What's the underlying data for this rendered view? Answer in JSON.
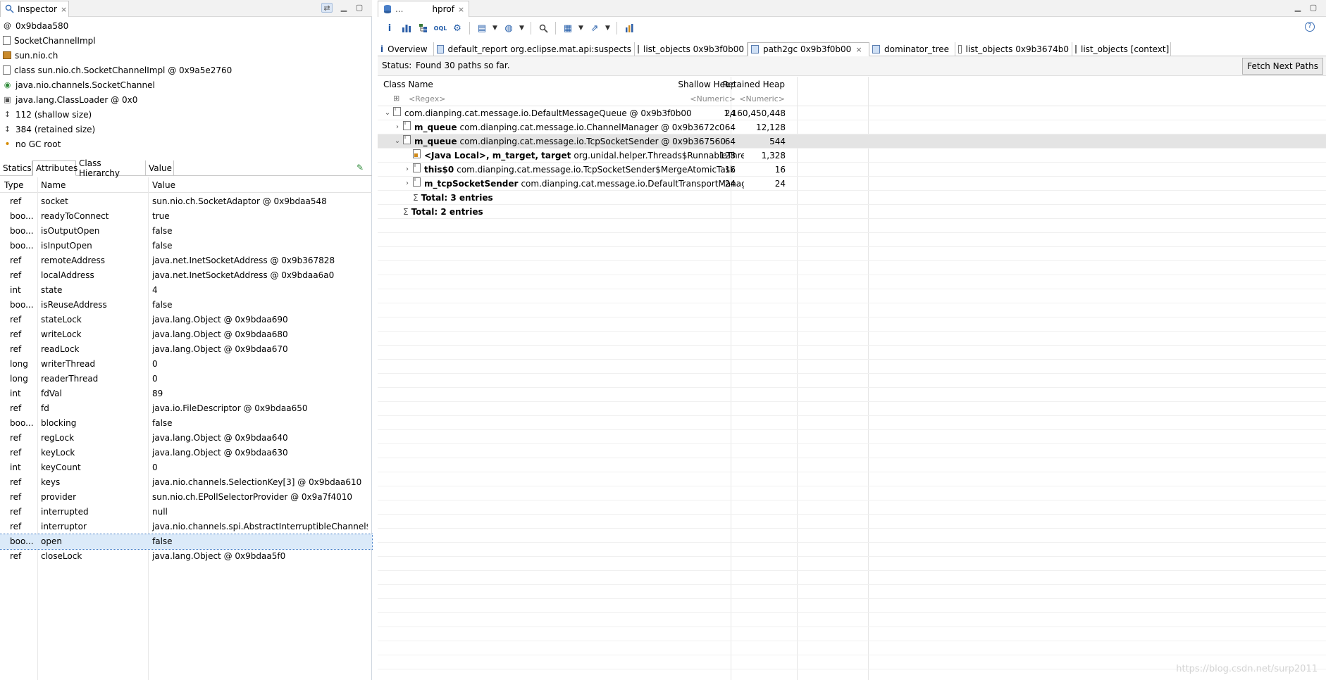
{
  "inspector": {
    "title": "Inspector",
    "close_glyph": "×",
    "info": [
      {
        "icon": "at-icon",
        "text": "0x9bdaa580"
      },
      {
        "icon": "class-doc-icon",
        "text": "SocketChannelImpl"
      },
      {
        "icon": "package-icon",
        "text": "sun.nio.ch"
      },
      {
        "icon": "class-doc-icon",
        "text": "class sun.nio.ch.SocketChannelImpl @ 0x9a5e2760"
      },
      {
        "icon": "interface-icon",
        "text": "java.nio.channels.SocketChannel"
      },
      {
        "icon": "classloader-icon",
        "text": "java.lang.ClassLoader @ 0x0"
      },
      {
        "icon": "size-icon",
        "text": "112 (shallow size)"
      },
      {
        "icon": "size-icon",
        "text": "384 (retained size)"
      },
      {
        "icon": "gc-root-icon",
        "text": "no GC root"
      }
    ],
    "tabs": [
      "Statics",
      "Attributes",
      "Class Hierarchy",
      "Value"
    ],
    "active_tab": "Attributes",
    "columns": {
      "type": "Type",
      "name": "Name",
      "value": "Value"
    },
    "rows": [
      {
        "type": "ref",
        "name": "socket",
        "value": "sun.nio.ch.SocketAdaptor @ 0x9bdaa548"
      },
      {
        "type": "boo...",
        "name": "readyToConnect",
        "value": "true"
      },
      {
        "type": "boo...",
        "name": "isOutputOpen",
        "value": "false"
      },
      {
        "type": "boo...",
        "name": "isInputOpen",
        "value": "false"
      },
      {
        "type": "ref",
        "name": "remoteAddress",
        "value": "java.net.InetSocketAddress @ 0x9b367828"
      },
      {
        "type": "ref",
        "name": "localAddress",
        "value": "java.net.InetSocketAddress @ 0x9bdaa6a0"
      },
      {
        "type": "int",
        "name": "state",
        "value": "4"
      },
      {
        "type": "boo...",
        "name": "isReuseAddress",
        "value": "false"
      },
      {
        "type": "ref",
        "name": "stateLock",
        "value": "java.lang.Object @ 0x9bdaa690"
      },
      {
        "type": "ref",
        "name": "writeLock",
        "value": "java.lang.Object @ 0x9bdaa680"
      },
      {
        "type": "ref",
        "name": "readLock",
        "value": "java.lang.Object @ 0x9bdaa670"
      },
      {
        "type": "long",
        "name": "writerThread",
        "value": "0"
      },
      {
        "type": "long",
        "name": "readerThread",
        "value": "0"
      },
      {
        "type": "int",
        "name": "fdVal",
        "value": "89"
      },
      {
        "type": "ref",
        "name": "fd",
        "value": "java.io.FileDescriptor @ 0x9bdaa650"
      },
      {
        "type": "boo...",
        "name": "blocking",
        "value": "false"
      },
      {
        "type": "ref",
        "name": "regLock",
        "value": "java.lang.Object @ 0x9bdaa640"
      },
      {
        "type": "ref",
        "name": "keyLock",
        "value": "java.lang.Object @ 0x9bdaa630"
      },
      {
        "type": "int",
        "name": "keyCount",
        "value": "0"
      },
      {
        "type": "ref",
        "name": "keys",
        "value": "java.nio.channels.SelectionKey[3] @ 0x9bdaa610"
      },
      {
        "type": "ref",
        "name": "provider",
        "value": "sun.nio.ch.EPollSelectorProvider @ 0x9a7f4010"
      },
      {
        "type": "ref",
        "name": "interrupted",
        "value": "null"
      },
      {
        "type": "ref",
        "name": "interruptor",
        "value": "java.nio.channels.spi.AbstractInterruptibleChannel$..."
      },
      {
        "type": "boo...",
        "name": "open",
        "value": "false",
        "selected": true
      },
      {
        "type": "ref",
        "name": "closeLock",
        "value": "java.lang.Object @ 0x9bdaa5f0"
      }
    ]
  },
  "editor": {
    "title_prefix": "...",
    "title": "hprof",
    "close_glyph": "×",
    "tabs": [
      {
        "label": "Overview",
        "icon": "info-icon"
      },
      {
        "label": "default_report  org.eclipse.mat.api:suspects",
        "icon": "report-icon"
      },
      {
        "label": "list_objects  0x9b3f0b00",
        "icon": "doc-icon"
      },
      {
        "label": "path2gc  0x9b3f0b00",
        "icon": "path-icon",
        "active": true
      },
      {
        "label": "dominator_tree",
        "icon": "tree-icon"
      },
      {
        "label": "list_objects  0x9b3674b0",
        "icon": "doc-icon"
      },
      {
        "label": "list_objects  [context]",
        "icon": "doc-icon"
      }
    ],
    "status_label": "Status:",
    "status_text": "Found 30 paths so far.",
    "fetch_button": "Fetch Next Paths",
    "columns": {
      "class_name": "Class Name",
      "shallow": "Shallow Heap",
      "retained": "Retained Heap"
    },
    "filters": {
      "class_name": "<Regex>",
      "shallow": "<Numeric>",
      "retained": "<Numeric>"
    },
    "rows": [
      {
        "depth": 0,
        "twist": "⌄",
        "icon": "doc",
        "field": "",
        "text": "com.dianping.cat.message.io.DefaultMessageQueue @ 0x9b3f0b00",
        "shallow": "24",
        "retained": "1,160,450,448"
      },
      {
        "depth": 1,
        "twist": "›",
        "icon": "doc",
        "field": "m_queue",
        "text": "com.dianping.cat.message.io.ChannelManager @ 0x9b3672c0",
        "shallow": "64",
        "retained": "12,128"
      },
      {
        "depth": 1,
        "twist": "⌄",
        "icon": "doc",
        "field": "m_queue",
        "text": "com.dianping.cat.message.io.TcpSocketSender @ 0x9b367560",
        "shallow": "64",
        "retained": "544",
        "selected": true
      },
      {
        "depth": 2,
        "twist": "",
        "icon": "local",
        "field": "<Java Local>, m_target, target",
        "text": "org.unidal.helper.Threads$RunnableThre",
        "shallow": "128",
        "retained": "1,328"
      },
      {
        "depth": 2,
        "twist": "›",
        "icon": "doc",
        "field": "this$0",
        "text": "com.dianping.cat.message.io.TcpSocketSender$MergeAtomicTask",
        "shallow": "16",
        "retained": "16"
      },
      {
        "depth": 2,
        "twist": "›",
        "icon": "doc",
        "field": "m_tcpSocketSender",
        "text": "com.dianping.cat.message.io.DefaultTransportManag",
        "shallow": "24",
        "retained": "24"
      },
      {
        "depth": 2,
        "twist": "",
        "icon": "sigma",
        "field": "",
        "text": "Total: 3 entries",
        "shallow": "",
        "retained": "",
        "total": true
      },
      {
        "depth": 1,
        "twist": "",
        "icon": "sigma",
        "field": "",
        "text": "Total: 2 entries",
        "shallow": "",
        "retained": "",
        "total": true
      }
    ]
  },
  "watermark": "https://blog.csdn.net/surp2011"
}
